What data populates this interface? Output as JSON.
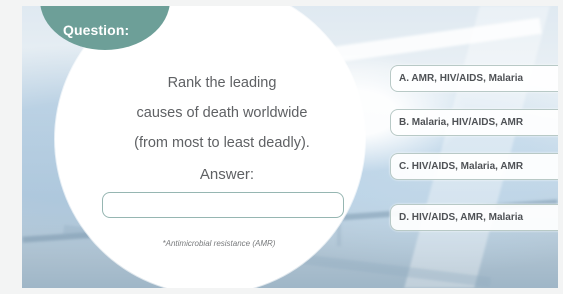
{
  "question": {
    "badge": "Question:",
    "lines": [
      "Rank the leading",
      "causes of death worldwide",
      "(from most to least deadly)."
    ]
  },
  "answer": {
    "label": "Answer:",
    "value": ""
  },
  "footnote": "*Antimicrobial resistance (AMR)",
  "options": [
    {
      "label": "A. AMR, HIV/AIDS, Malaria"
    },
    {
      "label": "B. Malaria, HIV/AIDS, AMR"
    },
    {
      "label": "C. HIV/AIDS, Malaria, AMR"
    },
    {
      "label": "D. HIV/AIDS, AMR, Malaria"
    }
  ],
  "colors": {
    "accent": "#6d9f98",
    "text": "#5f6164",
    "border": "#96b6b2"
  }
}
